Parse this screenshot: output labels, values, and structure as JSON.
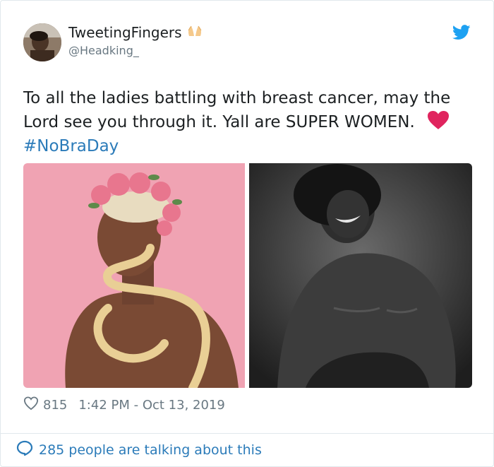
{
  "author": {
    "display_name": "TweetingFingers",
    "handle": "@Headking_",
    "name_emoji": "praying-hands-icon"
  },
  "tweet": {
    "text": "To all the ladies battling with breast cancer, may the Lord see you through it. Yall are SUPER WOMEN.",
    "hashtag": "#NoBraDay",
    "emoji": "red-heart-icon"
  },
  "media": {
    "count": 2
  },
  "meta": {
    "likes": "815",
    "timestamp": "1:42 PM - Oct 13, 2019"
  },
  "footer": {
    "talking_text": "285 people are talking about this"
  },
  "colors": {
    "link": "#2b7bb9",
    "muted": "#697882",
    "heart": "#e0245e",
    "bird": "#1da1f2"
  }
}
